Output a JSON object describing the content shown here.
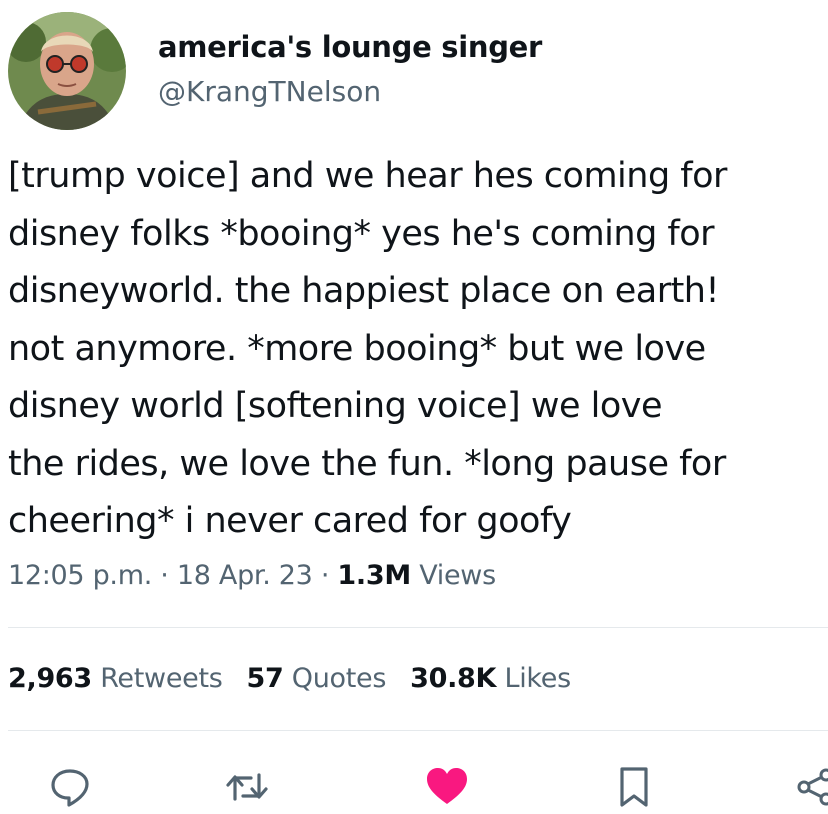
{
  "author": {
    "display_name": "america's lounge singer",
    "handle": "@KrangTNelson",
    "avatar_icon": "profile-photo"
  },
  "tweet": {
    "lines": [
      "[trump voice] and we hear hes coming for",
      "disney folks *booing* yes he's coming for",
      "disneyworld. the happiest place on earth!",
      "not anymore. *more booing* but we love",
      "disney world [softening voice] we love",
      "the rides, we love the fun. *long pause for",
      "cheering* i never cared for goofy"
    ]
  },
  "meta": {
    "time": "12:05 p.m.",
    "sep1": " · ",
    "date": "18 Apr. 23",
    "sep2": " · ",
    "views_count": "1.3M",
    "views_label": " Views"
  },
  "stats": {
    "retweets_count": "2,963",
    "retweets_label": " Retweets",
    "quotes_count": "57",
    "quotes_label": " Quotes",
    "likes_count": "30.8K",
    "likes_label": " Likes"
  },
  "actions": {
    "reply_icon": "reply-icon",
    "retweet_icon": "retweet-icon",
    "like_icon": "heart-icon",
    "bookmark_icon": "bookmark-icon",
    "share_icon": "share-icon",
    "like_color": "#f91880",
    "icon_color": "#536471"
  }
}
